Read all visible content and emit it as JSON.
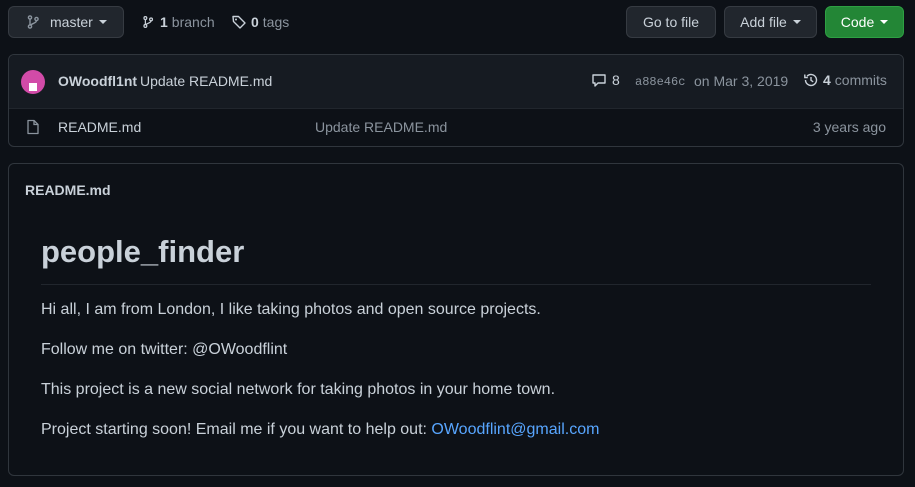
{
  "toolbar": {
    "branch_name": "master",
    "branch_count": "1",
    "branch_label": "branch",
    "tag_count": "0",
    "tag_label": "tags",
    "go_to_file_label": "Go to file",
    "add_file_label": "Add file",
    "code_label": "Code"
  },
  "commit": {
    "author": "OWoodfl1nt",
    "message": "Update README.md",
    "comment_count": "8",
    "sha": "a88e46c",
    "date": "on Mar 3, 2019",
    "commits_count": "4",
    "commits_label": "commits"
  },
  "files": [
    {
      "name": "README.md",
      "message": "Update README.md",
      "age": "3 years ago"
    }
  ],
  "readme": {
    "header": "README.md",
    "title": "people_finder",
    "paragraphs": [
      "Hi all, I am from London, I like taking photos and open source projects.",
      "Follow me on twitter: @OWoodflint",
      "This project is a new social network for taking photos in your home town."
    ],
    "email_prefix": "Project starting soon! Email me if you want to help out: ",
    "email": "OWoodflint@gmail.com"
  },
  "colors": {
    "background": "#0d1117",
    "code_button": "#238636",
    "link": "#58a6ff",
    "avatar": "#d24ba8"
  }
}
